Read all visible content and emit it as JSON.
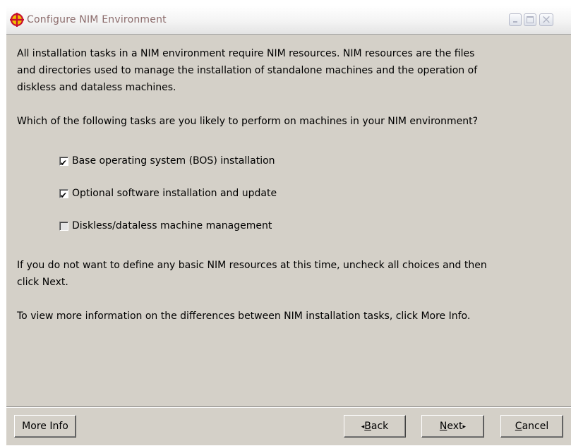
{
  "window": {
    "title": "Configure NIM Environment",
    "icon": "nim-crosshair-icon",
    "controls": {
      "minimize": "minimize-icon",
      "maximize": "maximize-icon",
      "close": "close-icon"
    }
  },
  "content": {
    "intro": "All installation tasks in a NIM environment require NIM resources.  NIM resources are the files\nand directories used to manage the  installation of standalone machines and the operation of\ndiskless  and dataless machines.",
    "question": "Which of the following tasks are you likely to perform on  machines in your NIM environment?",
    "options": [
      {
        "label": "Base operating system (BOS) installation",
        "checked": true
      },
      {
        "label": "Optional software installation and update",
        "checked": true
      },
      {
        "label": "Diskless/dataless machine management",
        "checked": false
      }
    ],
    "hint": "If you do not want to define any basic NIM resources at this time, uncheck all choices and then\nclick Next.",
    "more_info_text": "To view more information on the differences between NIM installation tasks, click More Info."
  },
  "buttons": {
    "more_info": "More Info",
    "back_mnemonic": "B",
    "back_rest": "ack",
    "next_mnemonic": "N",
    "next_rest": "ext",
    "cancel_mnemonic": "C",
    "cancel_rest": "ancel",
    "back_arrow": "◂",
    "next_arrow": "▸"
  },
  "colors": {
    "window_bg": "#d4d0c8",
    "title_text": "#8c6c6c",
    "icon_red": "#c8102e",
    "icon_yellow": "#f2c200"
  }
}
